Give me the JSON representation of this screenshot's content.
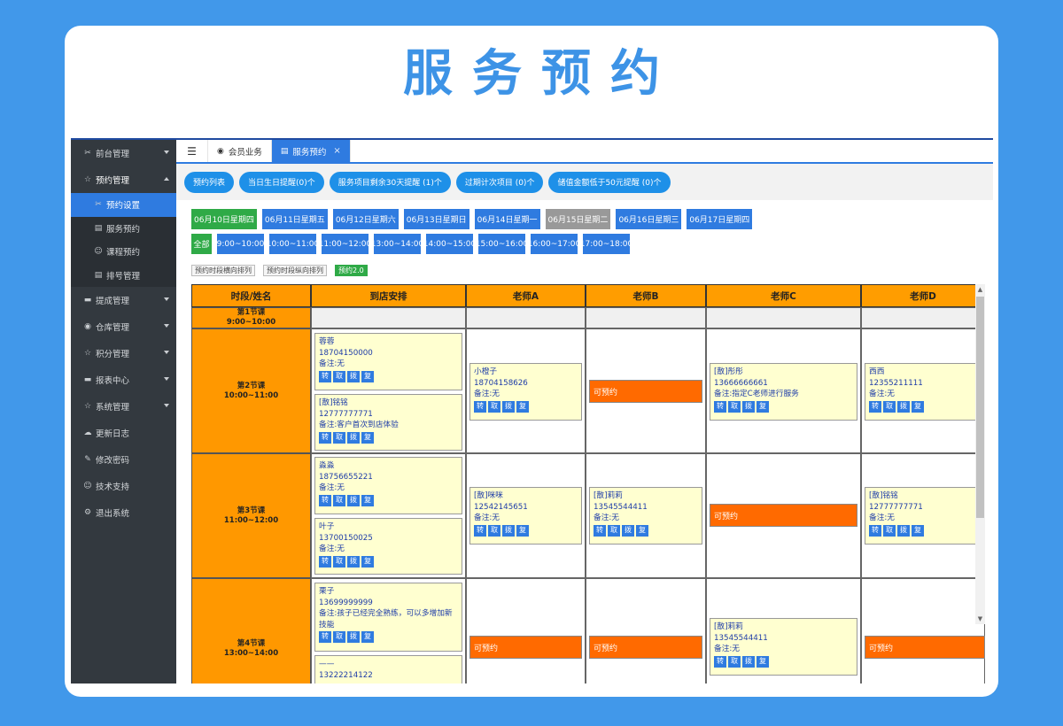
{
  "hero_title": "服务预约",
  "sidebar": {
    "items": [
      {
        "icon": "wrench-icon",
        "glyph": "✂",
        "label": "前台管理",
        "caret": "down"
      },
      {
        "icon": "star-icon",
        "glyph": "☆",
        "label": "预约管理",
        "caret": "up"
      }
    ],
    "sub": [
      {
        "icon": "wrench-icon",
        "glyph": "✂",
        "label": "预约设置",
        "active": true
      },
      {
        "icon": "doc-icon",
        "glyph": "▤",
        "label": "服务预约"
      },
      {
        "icon": "smile-icon",
        "glyph": "☺",
        "label": "课程预约"
      },
      {
        "icon": "doc-icon",
        "glyph": "▤",
        "label": "排号管理"
      }
    ],
    "items2": [
      {
        "icon": "card-icon",
        "glyph": "▬",
        "label": "提成管理",
        "caret": "down"
      },
      {
        "icon": "dashboard-icon",
        "glyph": "◉",
        "label": "仓库管理",
        "caret": "down"
      },
      {
        "icon": "star-icon",
        "glyph": "☆",
        "label": "积分管理",
        "caret": "down"
      },
      {
        "icon": "card-icon",
        "glyph": "▬",
        "label": "报表中心",
        "caret": "down"
      },
      {
        "icon": "star-icon",
        "glyph": "☆",
        "label": "系统管理",
        "caret": "down"
      },
      {
        "icon": "cloud-icon",
        "glyph": "☁",
        "label": "更新日志"
      },
      {
        "icon": "edit-icon",
        "glyph": "✎",
        "label": "修改密码"
      },
      {
        "icon": "smile-icon",
        "glyph": "☺",
        "label": "技术支持"
      },
      {
        "icon": "gears-icon",
        "glyph": "⚙",
        "label": "退出系统"
      }
    ]
  },
  "tabs": {
    "menu_glyph": "☰",
    "member": "会员业务",
    "active": "服务预约",
    "close": "×"
  },
  "reminders": [
    "预约列表",
    "当日生日提醒(0)个",
    "服务项目剩余30天提醒 (1)个",
    "过期计次项目 (0)个",
    "储值金额低于50元提醒 (0)个"
  ],
  "dates": [
    {
      "label": "06月10日星期四",
      "style": "green"
    },
    {
      "label": "06月11日星期五",
      "style": "blue"
    },
    {
      "label": "06月12日星期六",
      "style": "blue"
    },
    {
      "label": "06月13日星期日",
      "style": "blue"
    },
    {
      "label": "06月14日星期一",
      "style": "blue"
    },
    {
      "label": "06月15日星期二",
      "style": "gray"
    },
    {
      "label": "06月16日星期三",
      "style": "blue"
    },
    {
      "label": "06月17日星期四",
      "style": "blue"
    }
  ],
  "times": [
    "全部",
    "9:00~10:00",
    "10:00~11:00",
    "11:00~12:00",
    "13:00~14:00",
    "14:00~15:00",
    "15:00~16:00",
    "16:00~17:00",
    "17:00~18:00"
  ],
  "view_buttons": [
    "预约时段横向排列",
    "预约时段纵向排列",
    "预约2.0"
  ],
  "columns": [
    "时段/姓名",
    "到店安排",
    "老师A",
    "老师B",
    "老师C",
    "老师D"
  ],
  "periods": [
    {
      "name": "第1节课",
      "time": "9:00~10:00"
    },
    {
      "name": "第2节课",
      "time": "10:00~11:00"
    },
    {
      "name": "第3节课",
      "time": "11:00~12:00"
    },
    {
      "name": "第4节课",
      "time": "13:00~14:00"
    }
  ],
  "actions": [
    "转",
    "取",
    "拨",
    "复"
  ],
  "avail_label": "可预约",
  "bookings": {
    "p2_arrive_1": {
      "name": "蓉蓉",
      "phone": "18704150000",
      "note": "备注:无"
    },
    "p2_arrive_2": {
      "name": "[散]铭铭",
      "phone": "12777777771",
      "note": "备注:客户首次到店体验"
    },
    "p2_a": {
      "name": "小橙子",
      "phone": "18704158626",
      "note": "备注:无"
    },
    "p2_c": {
      "name": "[散]彤彤",
      "phone": "13666666661",
      "note": "备注:指定C老师进行服务"
    },
    "p2_d": {
      "name": "西西",
      "phone": "12355211111",
      "note": "备注:无"
    },
    "p3_arrive_1": {
      "name": "淼淼",
      "phone": "18756655221",
      "note": "备注:无"
    },
    "p3_arrive_2": {
      "name": "叶子",
      "phone": "13700150025",
      "note": "备注:无"
    },
    "p3_a": {
      "name": "[散]咪咪",
      "phone": "12542145651",
      "note": "备注:无"
    },
    "p3_b": {
      "name": "[散]莉莉",
      "phone": "13545544411",
      "note": "备注:无"
    },
    "p3_d": {
      "name": "[散]铭铭",
      "phone": "12777777771",
      "note": "备注:无"
    },
    "p4_arrive_1": {
      "name": "栗子",
      "phone": "13699999999",
      "note": "备注:孩子已经完全熟练，可以多增加新技能"
    },
    "p4_arrive_2": {
      "name": "——",
      "phone": "13222214122",
      "note": ""
    },
    "p4_c": {
      "name": "[散]莉莉",
      "phone": "13545544411",
      "note": "备注:无"
    }
  },
  "scroll": {
    "up": "▲",
    "down": "▼"
  }
}
